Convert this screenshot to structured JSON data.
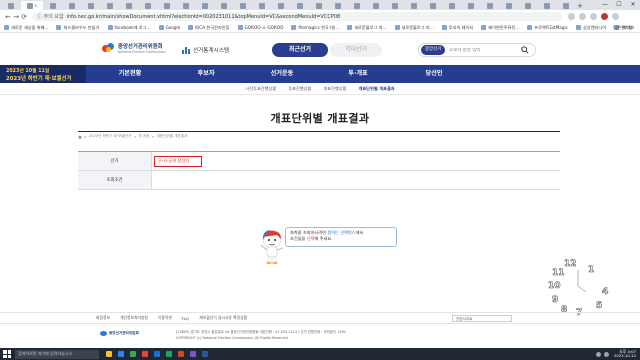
{
  "browser": {
    "url": "info.nec.go.kr/main/showDocument.xhtml?electionId=0020231011&topMenuId=VC&secondMenuId=VCCP08",
    "url_warning": "주의 요함",
    "tab_count": 30,
    "new_tab": "+",
    "controls": {
      "minimize": "—",
      "maximize": "☐",
      "close": "✕"
    },
    "bookmarks": [
      "새로운 세상을 위해...",
      "워드클라우드 만들기",
      "facebook에 로그...",
      "Google",
      "KICA 한국전자인증",
      "GOROO-소 GOROO",
      "filemagics 한국 I원...",
      "새로운블로그 마...",
      "새로운블로그 마...",
      "투자의 제이지",
      "왜이한민주화전...",
      "프로젝트GitMagic",
      "상상엔지니어",
      "편가평"
    ],
    "bookmarks_other": "다른 북마크"
  },
  "header": {
    "logo_line1": "중앙선거관리위원회",
    "logo_line2": "National Election Commission",
    "system_name": "선거통계시스템",
    "tab_recent": "최근선거",
    "tab_past": "역대선거",
    "search_tag": "중앙선거",
    "search_placeholder": "후보자 성명 입력"
  },
  "nav": {
    "banner_line1": "2023년 10월 11일",
    "banner_line2": "2023년 하반기 재·보궐선거",
    "items": [
      "기본현황",
      "후보자",
      "선거운동",
      "투·개표",
      "당선인"
    ]
  },
  "subnav": {
    "items": [
      "사전투표진행상황",
      "투표진행상황",
      "개표진행상황",
      "개표단위별 개표결과"
    ],
    "active_index": 3
  },
  "page": {
    "title": "개표단위별 개표결과",
    "breadcrumb": [
      "2023년 하반기 재·보궐선거",
      "투·개표",
      "개표단위별 개표결과"
    ],
    "breadcrumb_sep": ">",
    "form": {
      "election_label": "선거",
      "election_value": "구·시·군의 장선거",
      "condition_label": "조회조건"
    },
    "empty": {
      "line1_before": "좌측을 조회하시려면 ",
      "line1_blue": "원하는 선택박스",
      "line1_after": "에서",
      "line2_before": "조건들을 ",
      "line2_red": "선택",
      "line2_after": "해 주세요."
    }
  },
  "clock": {
    "numerals": [
      "12",
      "11",
      "10",
      "9",
      "8",
      "7",
      "5",
      "4",
      "1"
    ]
  },
  "footer": {
    "links": [
      "회원정보",
      "개인정보처리방침",
      "이용약관",
      "FAQ",
      "재보궐선거 실시사유 확정상황"
    ],
    "related_select": "관련사이트",
    "logo_text": "중앙선거관리위원회",
    "address_line1": "[13809] 경기도 과천시 홍촌말로 44 중앙선거관리위원회 대표전화 : 02-503-1114 / 선거 민원전화 : 국번없이 1390",
    "address_line2": "COPYRIGHT (c) National Election Commission, All Rights Reserved"
  },
  "taskbar": {
    "search_placeholder": "검색하려면 여기에 입력하십시오.",
    "time": "오후 4:07",
    "date": "2023-10-12"
  },
  "colors": {
    "brand_navy": "#253d8e",
    "banner_yellow": "#ffd44a",
    "highlight_red": "#e11c1c",
    "link_blue": "#2a6cd1"
  }
}
